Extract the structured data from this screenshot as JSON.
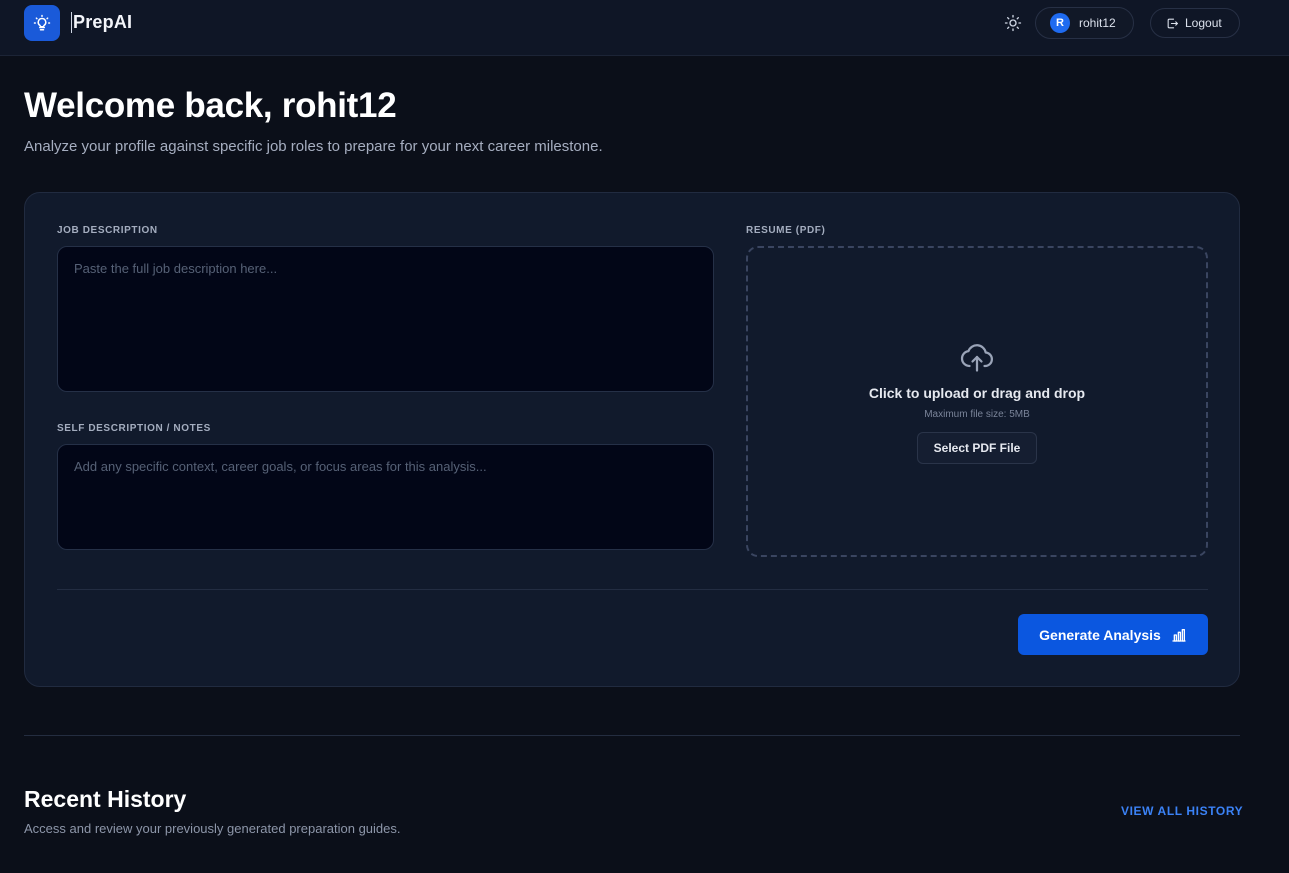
{
  "header": {
    "brand": "PrepAI",
    "user": {
      "initial": "R",
      "name": "rohit12"
    },
    "logout_label": "Logout"
  },
  "welcome": {
    "title": "Welcome back, rohit12",
    "subtitle": "Analyze your profile against specific job roles to prepare for your next career milestone."
  },
  "form": {
    "job_description": {
      "label": "JOB DESCRIPTION",
      "placeholder": "Paste the full job description here..."
    },
    "self_description": {
      "label": "SELF DESCRIPTION / NOTES",
      "placeholder": "Add any specific context, career goals, or focus areas for this analysis..."
    },
    "resume": {
      "label": "RESUME (PDF)",
      "title": "Click to upload or drag and drop",
      "hint": "Maximum file size: 5MB",
      "button": "Select PDF File"
    },
    "generate_label": "Generate Analysis"
  },
  "history": {
    "title": "Recent History",
    "subtitle": "Access and review your previously generated preparation guides.",
    "view_all": "VIEW ALL HISTORY"
  },
  "colors": {
    "accent": "#0b57e0",
    "background": "#0b0f19",
    "card": "#111a2c",
    "link": "#3b82f6"
  }
}
